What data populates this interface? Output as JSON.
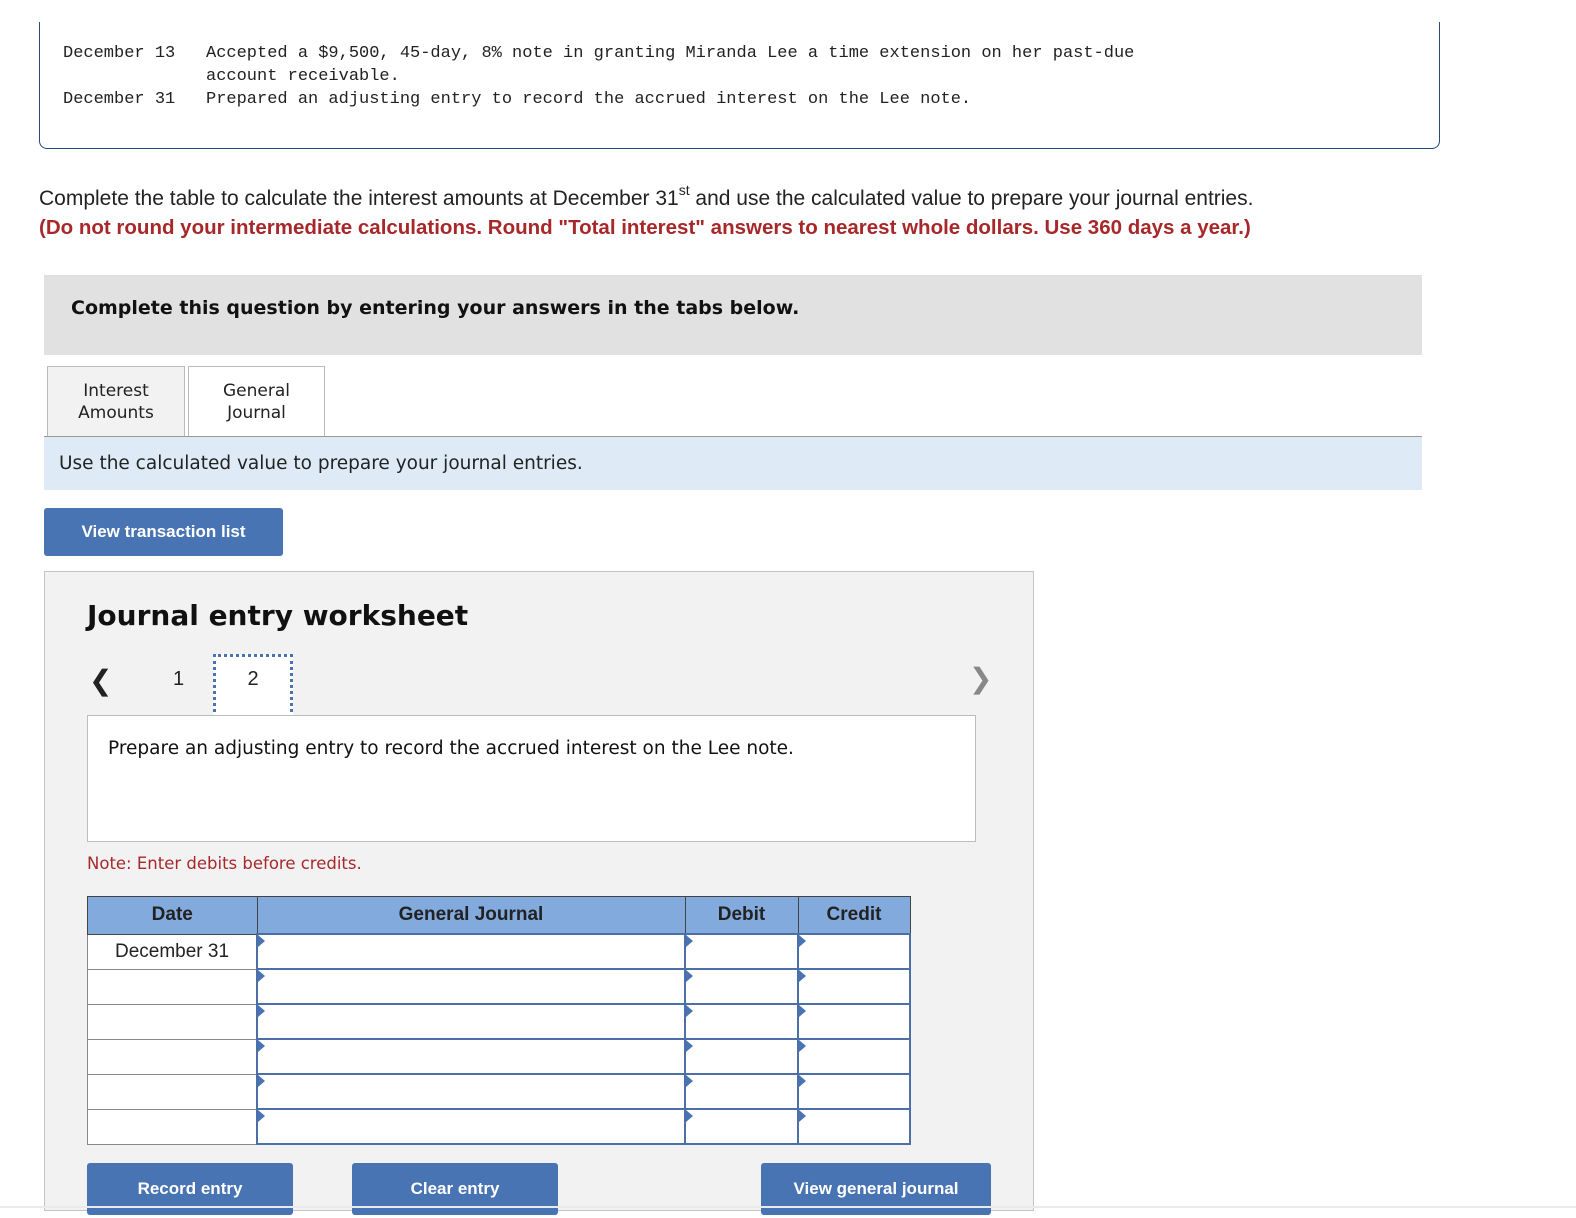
{
  "transactions": [
    {
      "date": "December 13",
      "text": "Accepted a $9,500, 45-day, 8% note in granting Miranda Lee a time extension on her past-due",
      "text_cont": "account receivable."
    },
    {
      "date": "December 31",
      "text": "Prepared an adjusting entry to record the accrued interest on the Lee note."
    }
  ],
  "instructions": {
    "main_before": "Complete the table to calculate the interest amounts at December 31",
    "main_sup": "st",
    "main_after": " and use the calculated value to prepare your journal entries.",
    "red": "(Do not round your intermediate calculations. Round \"Total interest\" answers to nearest whole dollars. Use 360 days a year.)"
  },
  "banner": "Complete this question by entering your answers in the tabs below.",
  "tabs": [
    {
      "label_line1": "Interest",
      "label_line2": "Amounts",
      "active": false
    },
    {
      "label_line1": "General",
      "label_line2": "Journal",
      "active": true
    }
  ],
  "tab_instruction": "Use the calculated value to prepare your journal entries.",
  "view_transaction_list_label": "View transaction list",
  "worksheet": {
    "title": "Journal entry worksheet",
    "prev_icon": "chevron-left-icon",
    "next_icon": "chevron-right-icon",
    "pages": [
      "1",
      "2"
    ],
    "current_page": "2",
    "prompt": "Prepare an adjusting entry to record the accrued interest on the Lee note.",
    "note": "Note: Enter debits before credits.",
    "table": {
      "headers": [
        "Date",
        "General Journal",
        "Debit",
        "Credit"
      ],
      "rows": [
        {
          "date": "December 31",
          "account": "",
          "debit": "",
          "credit": ""
        },
        {
          "date": "",
          "account": "",
          "debit": "",
          "credit": ""
        },
        {
          "date": "",
          "account": "",
          "debit": "",
          "credit": ""
        },
        {
          "date": "",
          "account": "",
          "debit": "",
          "credit": ""
        },
        {
          "date": "",
          "account": "",
          "debit": "",
          "credit": ""
        },
        {
          "date": "",
          "account": "",
          "debit": "",
          "credit": ""
        }
      ]
    },
    "buttons": {
      "record": "Record entry",
      "clear": "Clear entry",
      "view_journal": "View general journal"
    }
  },
  "colors": {
    "accent_blue": "#4874b4",
    "header_blue": "#82aadc",
    "warning_red": "#a8282a",
    "info_bg": "#deebf7"
  }
}
